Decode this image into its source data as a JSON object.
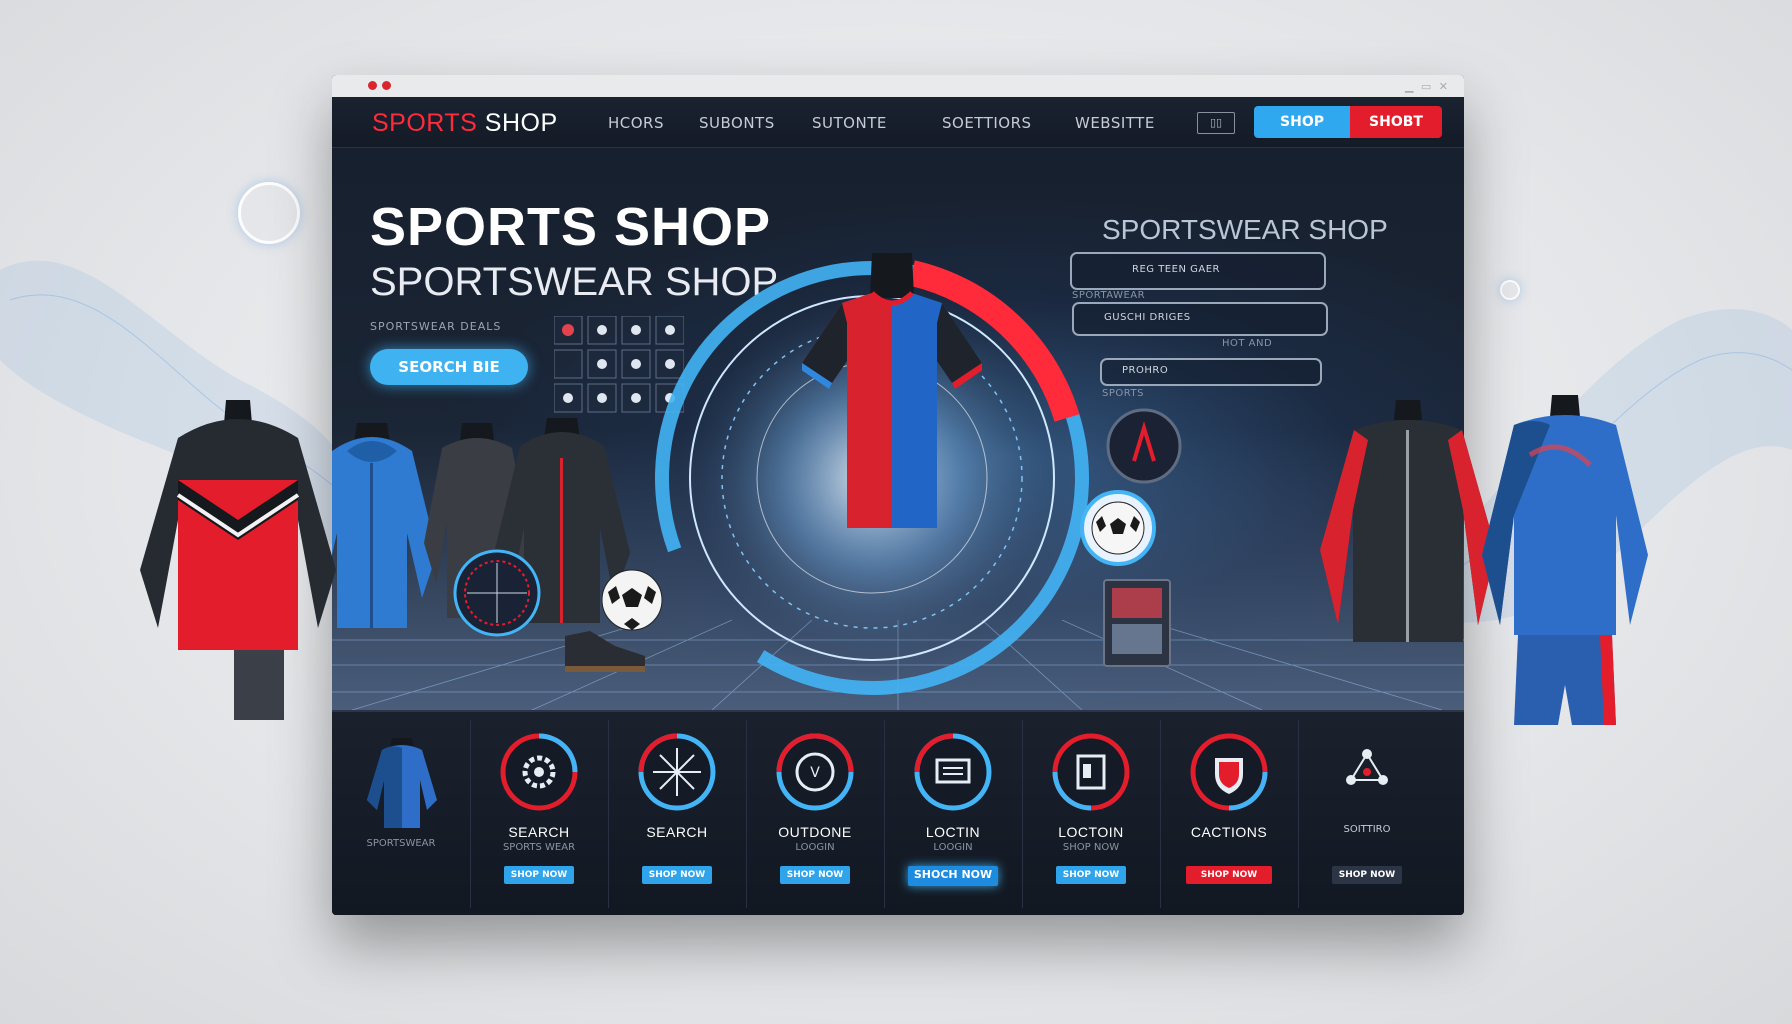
{
  "window": {
    "brand": {
      "part1": "SPORTS",
      "part2": " SHOP"
    },
    "nav_links": [
      "HCORS",
      "SUBONTS",
      "SUTONTE",
      "SOETTIORS",
      "WEBSITTE"
    ],
    "grid_icon_label": "▯▯",
    "nav_buttons": {
      "primary": "SHOP",
      "secondary": "SHOBT"
    }
  },
  "hero": {
    "title": "SPORTS SHOP",
    "subtitle": "SPORTSWEAR SHOP",
    "tagline": "SPORTSWEAR DEALS",
    "search_button": "SEORCH BIE",
    "right_title": "SPORTSWEAR SHOP",
    "info_cards": [
      {
        "text": "REG TEEN GAER"
      },
      {
        "text": "GUSCHI DRIGES"
      },
      {
        "text": "PROHRO"
      }
    ],
    "info_captions": [
      "SPORTAWEAR",
      "HOT AND",
      "SPORTS"
    ]
  },
  "footer_cards": [
    {
      "label": "",
      "sub": "SPORTSWEAR",
      "button": "",
      "icon": "jersey-thumbnail"
    },
    {
      "label": "SEARCH",
      "sub": "SPORTS WEAR",
      "button": "SHOP NOW",
      "icon": "gear-icon"
    },
    {
      "label": "SEARCH",
      "sub": "",
      "button": "SHOP NOW",
      "icon": "compass-icon"
    },
    {
      "label": "OUTDONE",
      "sub": "LOOGIN",
      "button": "SHOP NOW",
      "icon": "target-icon"
    },
    {
      "label": "LOCTIN",
      "sub": "LOOGIN",
      "button": "SHOCH NOW",
      "icon": "screen-icon"
    },
    {
      "label": "LOCTOIN",
      "sub": "SHOP NOW",
      "button": "SHOP NOW",
      "icon": "calendar-icon"
    },
    {
      "label": "CACTIONS",
      "sub": "",
      "button": "SHOP NOW",
      "icon": "shield-icon"
    },
    {
      "label": "",
      "sub": "SOITTIRO",
      "button": "SHOP NOW",
      "icon": "network-icon"
    }
  ],
  "colors": {
    "accent_blue": "#3fb2f2",
    "accent_red": "#ff2a3a",
    "background": "#0f1520"
  }
}
